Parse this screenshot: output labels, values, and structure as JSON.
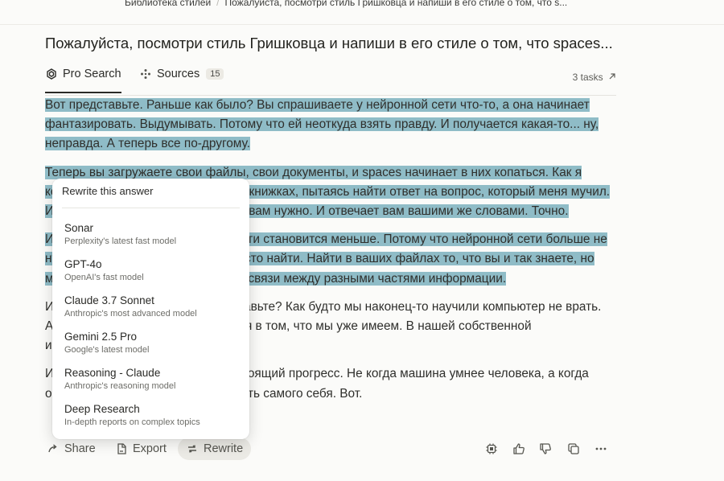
{
  "breadcrumb": {
    "items": [
      "Библиотека стилей",
      "Пожалуйста, посмотри стиль Гришковца и напиши в его стиле о том, что s..."
    ]
  },
  "thread": {
    "title": "Пожалуйста, посмотри стиль Гришковца и напиши в его стиле о том, что spaces..."
  },
  "tabs": {
    "pro_search": "Pro Search",
    "sources": "Sources",
    "sources_count": "15",
    "tasks": "3 tasks"
  },
  "answer": {
    "paragraphs": [
      "Вот представьте. Раньше как было? Вы спрашиваете у нейронной сети что-то, а она начинает фантазировать. Выдумывать. Потому что ей неоткуда взять правду. И получается какая-то... ну, неправда. А теперь все по-другому.",
      "Теперь вы загружаете свои файлы, свои документы, и spaces начинает в них копаться. Как я когда-то копался в своих записных книжках, пытаясь найти ответ на вопрос, который меня мучил. И находит. Находит именно то, что вам нужно. И отвечает вам вашими же словами. Точно.",
      "И знаете, что удивительно? Глупости становится меньше. Потому что нейронной сети больше не нужно придумывать. Ей нужно просто найти. Найти в ваших файлах то, что вы и так знаете, но может быть, не замечали. Увидеть связи между разными частями информации.",
      "И разве это не прекрасно? Представьте? Как будто мы наконец-то научили компьютер не врать. А просто помогать нам разобраться в том, что мы уже имеем. В нашей собственной информации. В наших знаниях.",
      "И вот это, мне кажется, и есть настоящий прогресс. Не когда машина умнее человека, а когда она помогает человеку лучше понять самого себя. Вот."
    ]
  },
  "actions": {
    "share": "Share",
    "export": "Export",
    "rewrite": "Rewrite"
  },
  "rewrite_menu": {
    "header": "Rewrite this answer",
    "models": [
      {
        "name": "Sonar",
        "desc": "Perplexity's latest fast model"
      },
      {
        "name": "GPT-4o",
        "desc": "OpenAI's fast model"
      },
      {
        "name": "Claude 3.7 Sonnet",
        "desc": "Anthropic's most advanced model"
      },
      {
        "name": "Gemini 2.5 Pro",
        "desc": "Google's latest model"
      },
      {
        "name": "Reasoning - Claude",
        "desc": "Anthropic's reasoning model"
      },
      {
        "name": "Deep Research",
        "desc": "In-depth reports on complex topics"
      }
    ]
  },
  "colors": {
    "selection_highlight": "#8fbcc7",
    "page_background": "#fbfbf9"
  }
}
